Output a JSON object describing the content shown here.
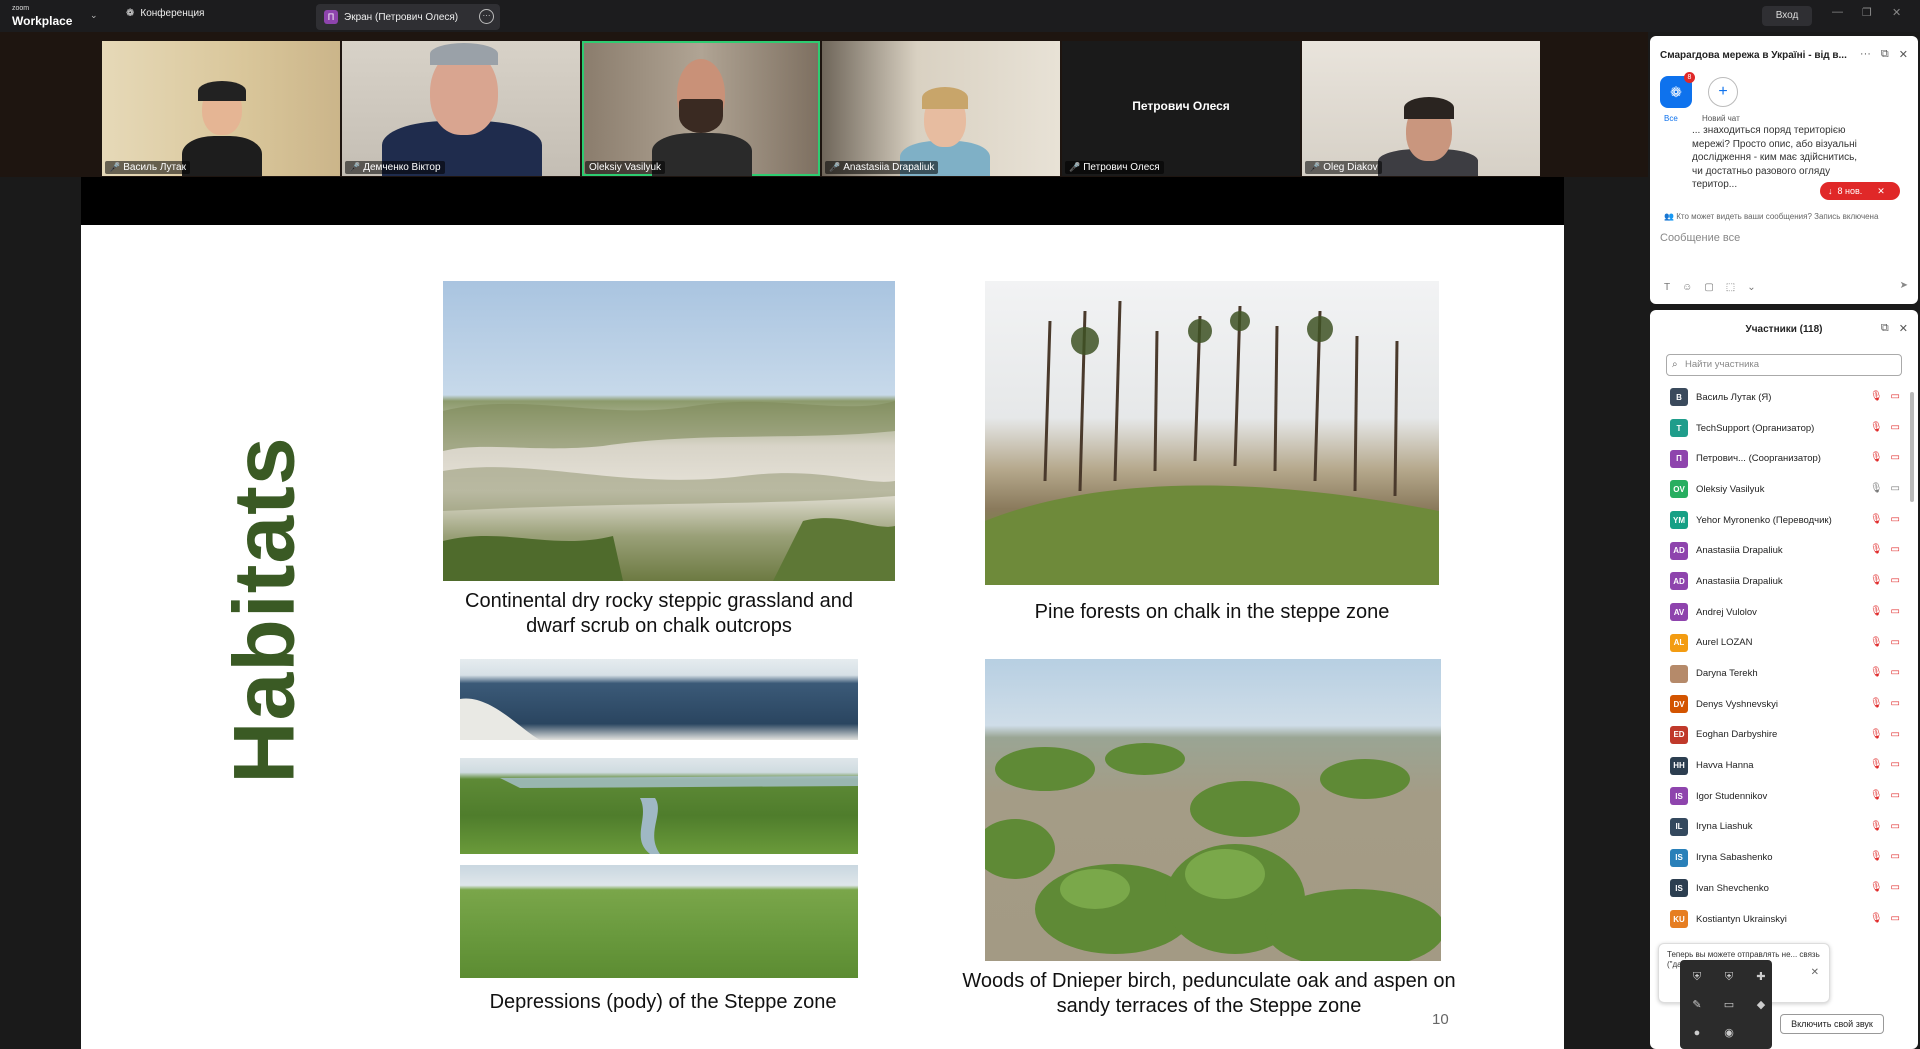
{
  "topbar": {
    "brand_small": "zoom",
    "brand_main": "Workplace",
    "conference_tab": "Конференция",
    "screen_tab": "Экран (Петрович Олеся)",
    "screen_badge": "П",
    "more_symbol": "···",
    "signin": "Вход"
  },
  "videos": [
    {
      "name": "Василь Лутак",
      "muted": true
    },
    {
      "name": "Демченко Віктор",
      "muted": true
    },
    {
      "name": "Oleksiy Vasilyuk",
      "muted": false,
      "speaking": true
    },
    {
      "name": "Anastasiia Drapaliuk",
      "muted": true
    },
    {
      "name": "Петрович Олеся",
      "muted": true,
      "video_off": true
    },
    {
      "name": "Oleg Diakov",
      "muted": true
    }
  ],
  "slide": {
    "title": "Habitats",
    "captions": {
      "tl": "Continental dry rocky steppic grassland and dwarf scrub on chalk outcrops",
      "tr": "Pine forests on chalk in the steppe zone",
      "bl": "Depressions (pody) of the Steppe zone",
      "br": "Woods of Dnieper birch, pedunculate oak and aspen on sandy terraces of the Steppe zone"
    },
    "page": "10",
    "title_color": "#3a5a24"
  },
  "chat": {
    "title": "Смарагдова мережа в Україні - від в...",
    "all_label": "Все",
    "all_badge": "8",
    "new_chat_label": "Новий чат",
    "message": "... знаходиться поряд територією мережі? Просто опис, або візуальні дослідження - ким має здійснитись, чи достатньо разового огляду територ...",
    "new_pill": "8 нов.",
    "visibility": "Кто может видеть ваши сообщения? Запись включена",
    "input_placeholder": "Сообщение все"
  },
  "participants": {
    "title": "Участники (118)",
    "search_placeholder": "Найти участника",
    "list": [
      {
        "initials": "В",
        "name": "Василь Лутак (Я)",
        "color": "#3a4a5c"
      },
      {
        "initials": "T",
        "name": "TechSupport (Организатор)",
        "color": "#1f9d8b"
      },
      {
        "initials": "П",
        "name": "Петрович... (Соорганизатор)",
        "color": "#8e44ad"
      },
      {
        "initials": "OV",
        "name": "Oleksiy Vasilyuk",
        "color": "#27ae60"
      },
      {
        "initials": "YM",
        "name": "Yehor Myronenko (Переводчик)",
        "color": "#16a085"
      },
      {
        "initials": "AD",
        "name": "Anastasiia Drapaliuk",
        "color": "#8e44ad"
      },
      {
        "initials": "AD",
        "name": "Anastasiia Drapaliuk",
        "color": "#8e44ad"
      },
      {
        "initials": "AV",
        "name": "Andrej Vulolov",
        "color": "#8e44ad"
      },
      {
        "initials": "AL",
        "name": "Aurel LOZAN",
        "color": "#f39c12"
      },
      {
        "initials": "",
        "name": "Daryna Terekh",
        "color": "#b58a6a"
      },
      {
        "initials": "DV",
        "name": "Denys Vyshnevskyi",
        "color": "#d35400"
      },
      {
        "initials": "ED",
        "name": "Eoghan Darbyshire",
        "color": "#c0392b"
      },
      {
        "initials": "HH",
        "name": "Havva Hanna",
        "color": "#2c3e50"
      },
      {
        "initials": "IS",
        "name": "Igor Studennikov",
        "color": "#8e44ad"
      },
      {
        "initials": "IL",
        "name": "Iryna Liashuk",
        "color": "#34495e"
      },
      {
        "initials": "IS",
        "name": "Iryna Sabashenko",
        "color": "#2980b9"
      },
      {
        "initials": "IS",
        "name": "Ivan Shevchenko",
        "color": "#2c3e50"
      },
      {
        "initials": "KU",
        "name": "Kostiantyn Ukrainskyi",
        "color": "#e67e22"
      }
    ]
  },
  "toast": {
    "text": "Теперь вы можете отправлять не... связь (\"да\", \"... меню \"Реакции\""
  },
  "unmute_button": "Включить свой звук"
}
